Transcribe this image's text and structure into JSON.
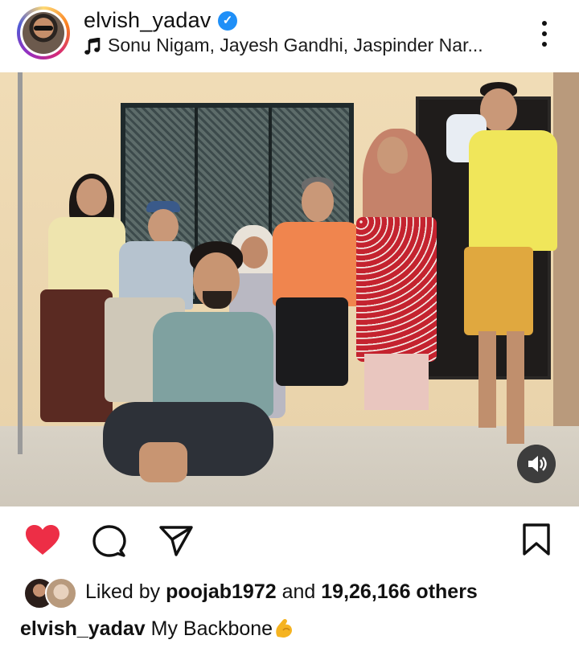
{
  "post": {
    "author": "elvish_yadav",
    "audio": "Sonu Nigam, Jayesh Gandhi, Jaspinder Nar...",
    "likes": {
      "prefix": "Liked by",
      "user": "poojab1972",
      "joiner": "and",
      "count": "19,26,166 others"
    },
    "caption": {
      "author": "elvish_yadav",
      "text": "My Backbone"
    }
  },
  "icons": {
    "verified": "verified-badge-icon",
    "music": "music-note-icon",
    "more": "more-vertical-icon",
    "sound": "speaker-icon",
    "like": "heart-icon",
    "comment": "comment-icon",
    "share": "send-icon",
    "save": "bookmark-icon",
    "emoji": "flexed-biceps-emoji"
  },
  "colors": {
    "like_red": "#ed2e46",
    "verified_blue": "#1f8ff7",
    "emoji_yellow": "#f5b321"
  }
}
